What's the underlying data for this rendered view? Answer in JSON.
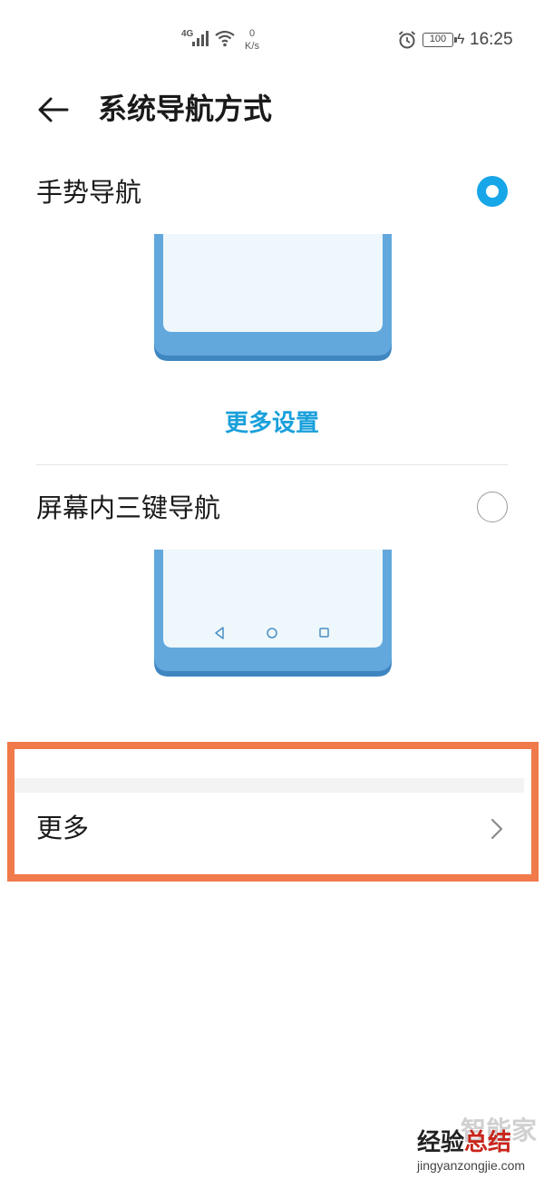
{
  "status_bar": {
    "network_type": "4G",
    "net_speed_value": "0",
    "net_speed_unit": "K/s",
    "battery_level": "100",
    "time": "16:25",
    "icons": [
      "signal-icon",
      "wifi-icon",
      "alarm-icon",
      "battery-icon",
      "charging-icon"
    ]
  },
  "header": {
    "back_icon": "arrow-left-icon",
    "title": "系统导航方式"
  },
  "options": [
    {
      "label": "手势导航",
      "selected": true
    },
    {
      "label": "屏幕内三键导航",
      "selected": false
    }
  ],
  "gesture_more_settings": "更多设置",
  "more_row": {
    "label": "更多",
    "icon": "chevron-right-icon"
  },
  "colors": {
    "accent": "#1aa0db",
    "radio_selected": "#17a6e8",
    "phone_frame": "#62a8dc",
    "phone_screen": "#eef7fb",
    "highlight_border": "#f07a4a"
  },
  "watermark": {
    "top_text": "智能家",
    "main_text_dark": "经验",
    "main_text_red": "总结",
    "url": "jingyanzongjie.com"
  }
}
